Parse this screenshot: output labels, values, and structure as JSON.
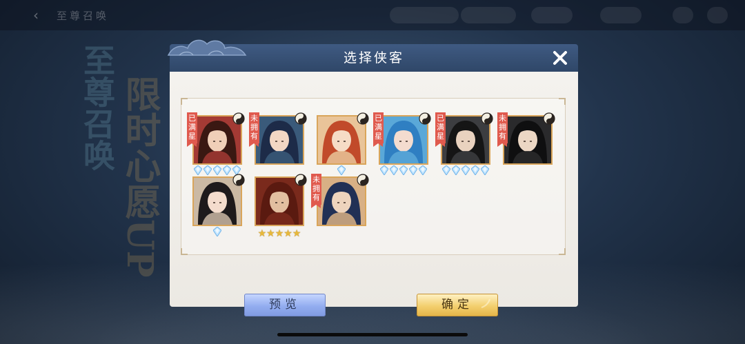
{
  "background": {
    "back_label": "‹",
    "title": "至尊召唤",
    "left_text_1": "至尊召唤",
    "left_text_2": "限时心愿UP"
  },
  "dialog": {
    "title": "选择侠客",
    "close_icon": "close-icon",
    "preview_label": "预览",
    "confirm_label": "确定"
  },
  "heroes": [
    {
      "tag": "已满星",
      "star_type": "gem",
      "stars": 5,
      "palette": [
        "#a33a34",
        "#f0cfb8",
        "#3a1812"
      ]
    },
    {
      "tag": "未拥有",
      "star_type": "none",
      "stars": 0,
      "palette": [
        "#3a5a7a",
        "#f2d7c4",
        "#1d2b48"
      ]
    },
    {
      "tag": "",
      "star_type": "gem",
      "stars": 1,
      "palette": [
        "#e9c499",
        "#f6dcc6",
        "#c14a2a"
      ]
    },
    {
      "tag": "已满星",
      "star_type": "gem",
      "stars": 5,
      "palette": [
        "#5aa8d8",
        "#f4dccf",
        "#2f7fc2"
      ]
    },
    {
      "tag": "已满星",
      "star_type": "gem",
      "stars": 5,
      "palette": [
        "#3c3d40",
        "#e9d2bf",
        "#151515"
      ]
    },
    {
      "tag": "未拥有",
      "star_type": "none",
      "stars": 0,
      "palette": [
        "#2a2a2c",
        "#ecd7c4",
        "#0f0f10"
      ]
    },
    {
      "tag": "",
      "star_type": "gem",
      "stars": 1,
      "palette": [
        "#cbb9a4",
        "#f4dccd",
        "#1e1a1c"
      ]
    },
    {
      "tag": "",
      "star_type": "gold",
      "stars": 5,
      "palette": [
        "#7a2a1c",
        "#e2bfa0",
        "#5a1a10"
      ]
    },
    {
      "tag": "未拥有",
      "star_type": "none",
      "stars": 0,
      "palette": [
        "#d8b085",
        "#eed4bd",
        "#213055"
      ]
    }
  ]
}
